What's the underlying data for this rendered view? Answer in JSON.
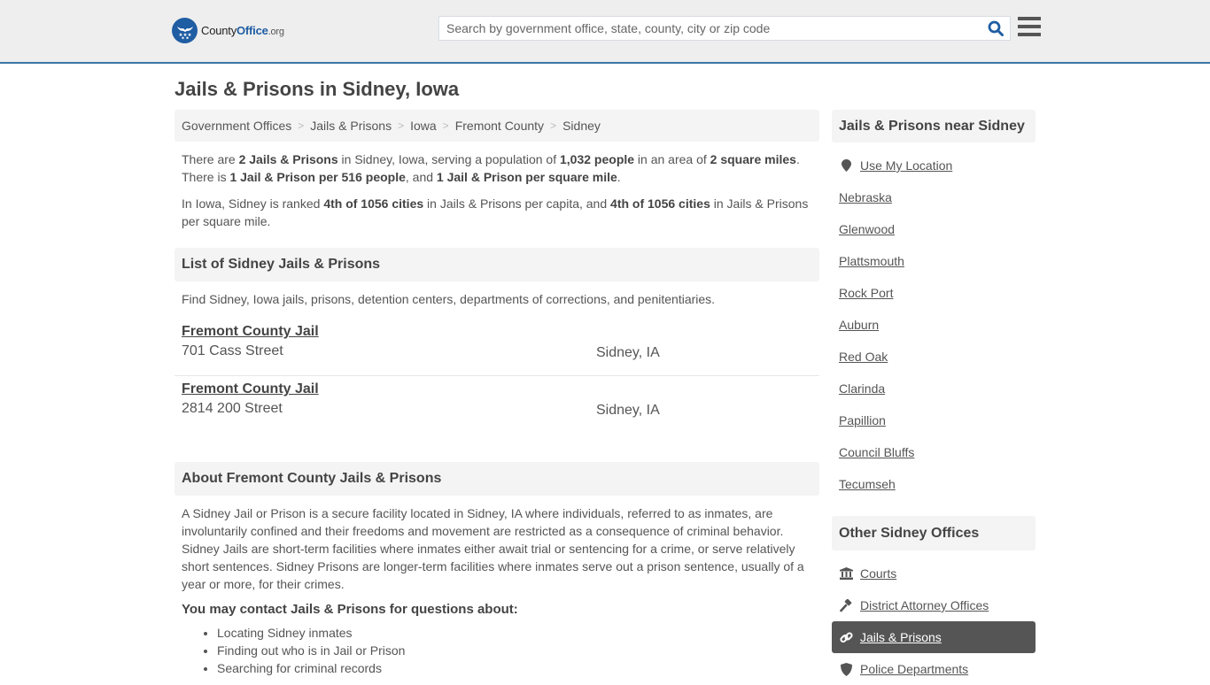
{
  "header": {
    "logo": {
      "part1": "County",
      "part2": "Office",
      "part3": ".org"
    },
    "search": {
      "placeholder": "Search by government office, state, county, city or zip code",
      "value": ""
    },
    "icons": {
      "search": "search-icon",
      "menu": "hamburger-menu-icon"
    }
  },
  "page_title": "Jails & Prisons in Sidney, Iowa",
  "breadcrumb": [
    "Government Offices",
    "Jails & Prisons",
    "Iowa",
    "Fremont County",
    "Sidney"
  ],
  "summary": {
    "p1": {
      "t1": "There are ",
      "b1": "2 Jails & Prisons",
      "t2": " in Sidney, Iowa, serving a population of ",
      "b2": "1,032 people",
      "t3": " in an area of ",
      "b3": "2 square miles",
      "t4": ". There is ",
      "b4": "1 Jail & Prison per 516 people",
      "t5": ", and ",
      "b5": "1 Jail & Prison per square mile",
      "t6": "."
    },
    "p2": {
      "t1": "In Iowa, Sidney is ranked ",
      "b1": "4th of 1056 cities",
      "t2": " in Jails & Prisons per capita, and ",
      "b2": "4th of 1056 cities",
      "t3": " in Jails & Prisons per square mile."
    }
  },
  "list_section": {
    "heading": "List of Sidney Jails & Prisons",
    "description": "Find Sidney, Iowa jails, prisons, detention centers, departments of corrections, and penitentiaries.",
    "items": [
      {
        "name": "Fremont County Jail",
        "address": "701 Cass Street",
        "city": "Sidney, IA"
      },
      {
        "name": "Fremont County Jail",
        "address": "2814 200 Street",
        "city": "Sidney, IA"
      }
    ]
  },
  "about_section": {
    "heading": "About Fremont County Jails & Prisons",
    "body": "A Sidney Jail or Prison is a secure facility located in Sidney, IA where individuals, referred to as inmates, are involuntarily confined and their freedoms and movement are restricted as a consequence of criminal behavior. Sidney Jails are short-term facilities where inmates either await trial or sentencing for a crime, or serve relatively short sentences. Sidney Prisons are longer-term facilities where inmates serve out a prison sentence, usually of a year or more, for their crimes.",
    "contact_heading": "You may contact Jails & Prisons for questions about:",
    "bullets": [
      "Locating Sidney inmates",
      "Finding out who is in Jail or Prison",
      "Searching for criminal records"
    ]
  },
  "sidebar": {
    "nearby_heading": "Jails & Prisons near Sidney",
    "use_location": {
      "label": "Use My Location",
      "icon": "map-marker-icon"
    },
    "nearby": [
      "Nebraska",
      "Glenwood",
      "Plattsmouth",
      "Rock Port",
      "Auburn",
      "Red Oak",
      "Clarinda",
      "Papillion",
      "Council Bluffs",
      "Tecumseh"
    ],
    "other_heading": "Other Sidney Offices",
    "other": [
      {
        "label": "Courts",
        "icon": "courthouse-icon",
        "active": false
      },
      {
        "label": "District Attorney Offices",
        "icon": "gavel-icon",
        "active": false
      },
      {
        "label": "Jails & Prisons",
        "icon": "link-icon",
        "active": true
      },
      {
        "label": "Police Departments",
        "icon": "shield-icon",
        "active": false
      }
    ]
  },
  "colors": {
    "brand": "#1f5da3",
    "header_border": "#3c76a6",
    "header_bg": "#eeeeee",
    "section_bg": "#f4f4f4",
    "active_bg": "#555555"
  }
}
